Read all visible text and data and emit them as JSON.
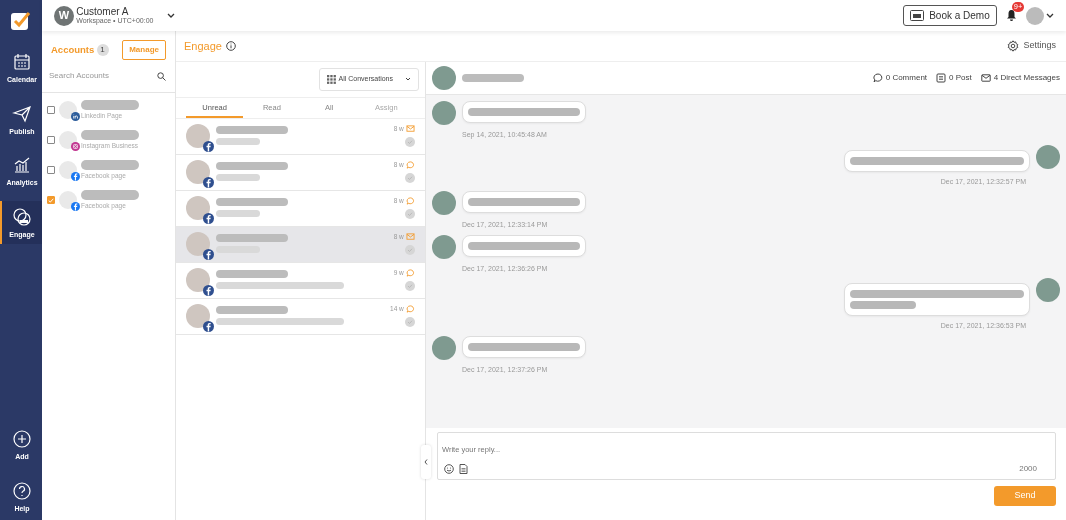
{
  "nav": [
    {
      "label": "Calendar",
      "kind": "calendar",
      "selected": false
    },
    {
      "label": "Publish",
      "kind": "publish",
      "selected": false
    },
    {
      "label": "Analytics",
      "kind": "analytics",
      "selected": false
    },
    {
      "label": "Engage",
      "kind": "engage",
      "selected": true
    }
  ],
  "nav_bottom": [
    {
      "label": "Add",
      "kind": "add"
    },
    {
      "label": "Help",
      "kind": "help"
    }
  ],
  "workspace": {
    "initial": "W",
    "name": "Customer A",
    "subtitle": "Workspace • UTC+00:00"
  },
  "topbar": {
    "demo_button": "Book a Demo",
    "notifications": "9+"
  },
  "accounts": {
    "title": "Accounts",
    "count": "1",
    "manage": "Manage",
    "search_placeholder": "Search Accounts",
    "items": [
      {
        "type": "Linkedin Page",
        "kind": "linkedin",
        "checked": false
      },
      {
        "type": "Instagram Business",
        "kind": "instagram",
        "checked": false
      },
      {
        "type": "Facebook page",
        "kind": "facebook",
        "checked": false
      },
      {
        "type": "Facebook page",
        "kind": "facebook",
        "checked": true
      }
    ]
  },
  "engage": {
    "title": "Engage",
    "settings": "Settings"
  },
  "filter": "All Conversations",
  "tabs": [
    {
      "label": "Unread",
      "selected": true,
      "disabled": false
    },
    {
      "label": "Read",
      "selected": false,
      "disabled": false
    },
    {
      "label": "All",
      "selected": false,
      "disabled": false
    },
    {
      "label": "Assign",
      "selected": false,
      "disabled": true
    }
  ],
  "conversations": [
    {
      "age": "8 w",
      "kind": "message",
      "long_preview": false,
      "selected": false
    },
    {
      "age": "8 w",
      "kind": "comment",
      "long_preview": false,
      "selected": false
    },
    {
      "age": "8 w",
      "kind": "comment",
      "long_preview": false,
      "selected": false
    },
    {
      "age": "8 w",
      "kind": "message",
      "long_preview": false,
      "selected": true
    },
    {
      "age": "9 w",
      "kind": "comment",
      "long_preview": true,
      "selected": false
    },
    {
      "age": "14 w",
      "kind": "comment",
      "long_preview": true,
      "selected": false
    }
  ],
  "chat": {
    "stats": [
      {
        "kind": "comment",
        "label": "0 Comment"
      },
      {
        "kind": "post",
        "label": "0 Post"
      },
      {
        "kind": "message",
        "label": "4 Direct Messages"
      }
    ],
    "messages": [
      {
        "kind": "incoming",
        "two_lines": false,
        "time": "Sep 14, 2021, 10:45:48 AM"
      },
      {
        "kind": "outgoing",
        "two_lines": false,
        "time": "Dec 17, 2021, 12:32:57 PM"
      },
      {
        "kind": "incoming",
        "two_lines": false,
        "time": "Dec 17, 2021, 12:33:14 PM"
      },
      {
        "kind": "incoming",
        "two_lines": false,
        "time": "Dec 17, 2021, 12:36:26 PM"
      },
      {
        "kind": "outgoing",
        "two_lines": true,
        "time": "Dec 17, 2021, 12:36:53 PM"
      },
      {
        "kind": "incoming",
        "two_lines": false,
        "time": "Dec 17, 2021, 12:37:26 PM"
      }
    ],
    "reply_placeholder": "Write your reply...",
    "char_count": "2000",
    "send": "Send"
  }
}
